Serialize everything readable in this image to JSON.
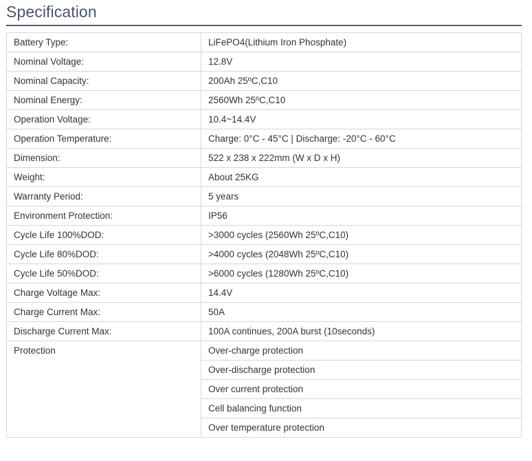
{
  "heading": "Specification",
  "rows": [
    {
      "label": "Battery Type:",
      "value": "LiFePO4(Lithium Iron Phosphate)"
    },
    {
      "label": "Nominal Voltage:",
      "value": "12.8V"
    },
    {
      "label": "Nominal Capacity:",
      "value": "200Ah 25ºC,C10"
    },
    {
      "label": "Nominal Energy:",
      "value": "2560Wh 25ºC,C10"
    },
    {
      "label": "Operation Voltage:",
      "value": "10.4~14.4V"
    },
    {
      "label": "Operation Temperature:",
      "value": "Charge: 0°C - 45°C | Discharge: -20°C - 60°C"
    },
    {
      "label": "Dimension:",
      "value": "522 x 238 x 222mm (W x D x H)"
    },
    {
      "label": "Weight:",
      "value": "About 25KG"
    },
    {
      "label": "Warranty Period:",
      "value": "5 years"
    },
    {
      "label": "Environment Protection:",
      "value": "IP56"
    },
    {
      "label": "Cycle Life 100%DOD:",
      "value": ">3000 cycles (2560Wh 25ºC,C10)"
    },
    {
      "label": "Cycle Life 80%DOD:",
      "value": ">4000 cycles (2048Wh 25ºC,C10)"
    },
    {
      "label": "Cycle Life 50%DOD:",
      "value": ">6000 cycles (1280Wh 25ºC,C10)"
    },
    {
      "label": "Charge Voltage Max:",
      "value": "14.4V"
    },
    {
      "label": "Charge Current Max:",
      "value": "50A"
    },
    {
      "label": "Discharge Current Max:",
      "value": "100A continues, 200A burst (10seconds)"
    }
  ],
  "protection": {
    "label": "Protection",
    "items": [
      "Over-charge protection",
      "Over-discharge protection",
      "Over current protection",
      "Cell balancing function",
      "Over temperature protection"
    ]
  }
}
